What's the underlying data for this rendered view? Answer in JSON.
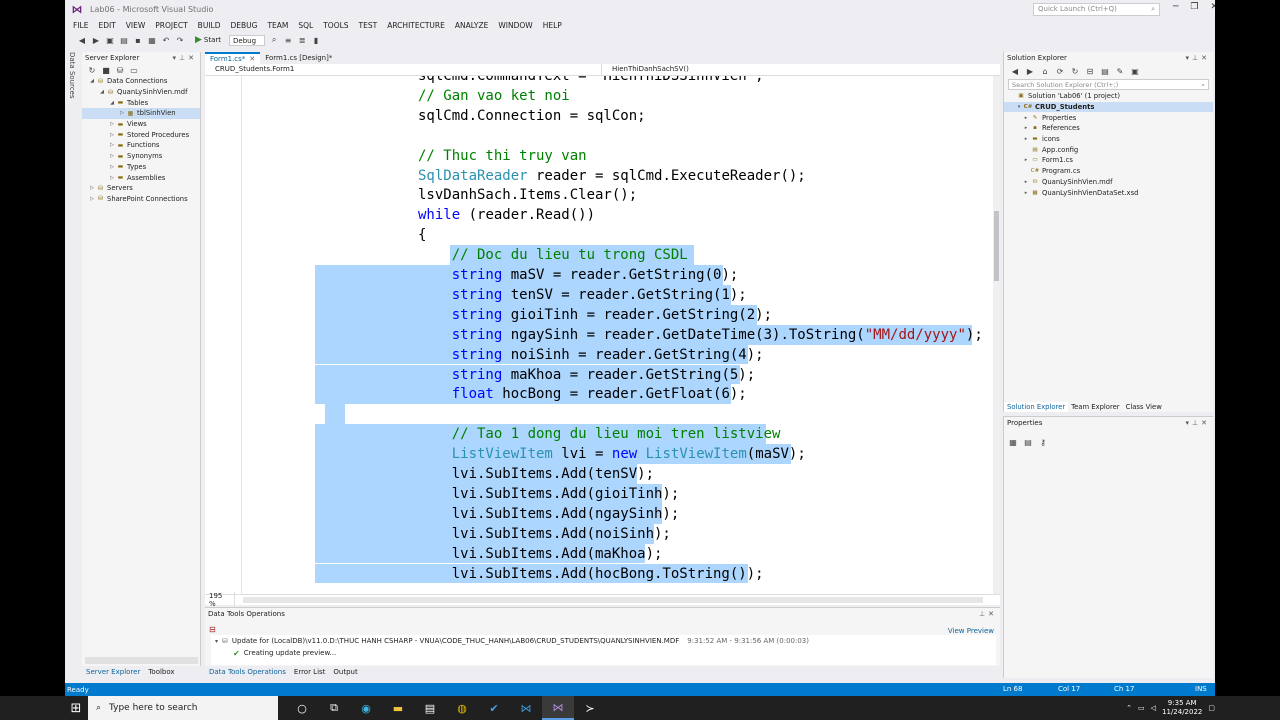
{
  "window": {
    "title": "Lab06 - Microsoft Visual Studio",
    "quick_launch": "Quick Launch (Ctrl+Q)"
  },
  "menu": [
    "FILE",
    "EDIT",
    "VIEW",
    "PROJECT",
    "BUILD",
    "DEBUG",
    "TEAM",
    "SQL",
    "TOOLS",
    "TEST",
    "ARCHITECTURE",
    "ANALYZE",
    "WINDOW",
    "HELP"
  ],
  "toolbar": {
    "start_label": "Start",
    "config_label": "Debug"
  },
  "side_tab": "Data Sources",
  "server_explorer": {
    "title": "Server Explorer",
    "tree": [
      {
        "label": "Data Connections",
        "indent": 0,
        "expanded": true
      },
      {
        "label": "QuanLySinhVien.mdf",
        "indent": 1,
        "expanded": true
      },
      {
        "label": "Tables",
        "indent": 2,
        "expanded": true
      },
      {
        "label": "tblSinhVien",
        "indent": 3,
        "expanded": false,
        "selected": true
      },
      {
        "label": "Views",
        "indent": 2,
        "expanded": false
      },
      {
        "label": "Stored Procedures",
        "indent": 2,
        "expanded": false
      },
      {
        "label": "Functions",
        "indent": 2,
        "expanded": false
      },
      {
        "label": "Synonyms",
        "indent": 2,
        "expanded": false
      },
      {
        "label": "Types",
        "indent": 2,
        "expanded": false
      },
      {
        "label": "Assemblies",
        "indent": 2,
        "expanded": false
      },
      {
        "label": "Servers",
        "indent": 0,
        "expanded": false
      },
      {
        "label": "SharePoint Connections",
        "indent": 0,
        "expanded": false
      }
    ],
    "bottom_tabs": [
      "Server Explorer",
      "Toolbox"
    ]
  },
  "editor": {
    "tabs": [
      {
        "label": "Form1.cs*",
        "active": true
      },
      {
        "label": "Form1.cs [Design]*",
        "active": false
      }
    ],
    "nav_left": "CRUD_Students.Form1",
    "nav_right": "HienThiDanhSachSV()",
    "zoom": "195 %",
    "lines": [
      [
        {
          "t": "sqlCmd.CommandText = \"HienThiDSSinhVien\";",
          "c": ""
        }
      ],
      [
        {
          "t": "// Gan vao ket noi",
          "c": "cm"
        }
      ],
      [
        {
          "t": "sqlCmd.Connection = sqlCon;",
          "c": ""
        }
      ],
      [
        {
          "t": "",
          "c": ""
        }
      ],
      [
        {
          "t": "// Thuc thi truy van",
          "c": "cm"
        }
      ],
      [
        {
          "t": "SqlDataReader",
          "c": "ty"
        },
        {
          "t": " reader = sqlCmd.ExecuteReader();",
          "c": ""
        }
      ],
      [
        {
          "t": "lsvDanhSach.Items.Clear();",
          "c": ""
        }
      ],
      [
        {
          "t": "while",
          "c": "kw"
        },
        {
          "t": " (reader.Read())",
          "c": ""
        }
      ],
      [
        {
          "t": "{",
          "c": ""
        }
      ],
      [
        {
          "t": "    // Doc du lieu tu trong CSDL",
          "c": "cm"
        }
      ],
      [
        {
          "t": "    ",
          "c": ""
        },
        {
          "t": "string",
          "c": "kw"
        },
        {
          "t": " maSV = reader.GetString(0);",
          "c": ""
        }
      ],
      [
        {
          "t": "    ",
          "c": ""
        },
        {
          "t": "string",
          "c": "kw"
        },
        {
          "t": " tenSV = reader.GetString(1);",
          "c": ""
        }
      ],
      [
        {
          "t": "    ",
          "c": ""
        },
        {
          "t": "string",
          "c": "kw"
        },
        {
          "t": " gioiTinh = reader.GetString(2);",
          "c": ""
        }
      ],
      [
        {
          "t": "    ",
          "c": ""
        },
        {
          "t": "string",
          "c": "kw"
        },
        {
          "t": " ngaySinh = reader.GetDateTime(3).ToString(",
          "c": ""
        },
        {
          "t": "\"MM/dd/yyyy\"",
          "c": "st"
        },
        {
          "t": ");",
          "c": ""
        }
      ],
      [
        {
          "t": "    ",
          "c": ""
        },
        {
          "t": "string",
          "c": "kw"
        },
        {
          "t": " noiSinh = reader.GetString(4);",
          "c": ""
        }
      ],
      [
        {
          "t": "    ",
          "c": ""
        },
        {
          "t": "string",
          "c": "kw"
        },
        {
          "t": " maKhoa = reader.GetString(5);",
          "c": ""
        }
      ],
      [
        {
          "t": "    ",
          "c": ""
        },
        {
          "t": "float",
          "c": "kw"
        },
        {
          "t": " hocBong = reader.GetFloat(6);",
          "c": ""
        }
      ],
      [
        {
          "t": "",
          "c": ""
        }
      ],
      [
        {
          "t": "    // Tao 1 dong du lieu moi tren listview",
          "c": "cm"
        }
      ],
      [
        {
          "t": "    ",
          "c": ""
        },
        {
          "t": "ListViewItem",
          "c": "ty"
        },
        {
          "t": " lvi = ",
          "c": ""
        },
        {
          "t": "new",
          "c": "kw"
        },
        {
          "t": " ",
          "c": ""
        },
        {
          "t": "ListViewItem",
          "c": "ty"
        },
        {
          "t": "(maSV);",
          "c": ""
        }
      ],
      [
        {
          "t": "    lvi.SubItems.Add(tenSV);",
          "c": ""
        }
      ],
      [
        {
          "t": "    lvi.SubItems.Add(gioiTinh);",
          "c": ""
        }
      ],
      [
        {
          "t": "    lvi.SubItems.Add(ngaySinh);",
          "c": ""
        }
      ],
      [
        {
          "t": "    lvi.SubItems.Add(noiSinh);",
          "c": ""
        }
      ],
      [
        {
          "t": "    lvi.SubItems.Add(maKhoa);",
          "c": ""
        }
      ],
      [
        {
          "t": "    lvi.SubItems.Add(hocBong.ToString());",
          "c": ""
        }
      ]
    ]
  },
  "data_tools": {
    "title": "Data Tools Operations",
    "op_text": "Update for (LocalDB)\\v11.0.D:\\THUC HANH CSHARP - VNUA\\CODE_THUC_HANH\\LAB06\\CRUD_STUDENTS\\QUANLYSINHVIEN.MDF",
    "op_time": "9:31:52 AM - 9:31:56 AM (0:00:03)",
    "op_sub": "Creating update preview...",
    "view_preview": "View Preview",
    "bottom_tabs": [
      "Data Tools Operations",
      "Error List",
      "Output"
    ]
  },
  "solution_explorer": {
    "title": "Solution Explorer",
    "search": "Search Solution Explorer (Ctrl+;)",
    "tree": [
      {
        "label": "Solution 'Lab06' (1 project)",
        "indent": 0,
        "icon": "solution-icon",
        "arrow": ""
      },
      {
        "label": "CRUD_Students",
        "indent": 1,
        "icon": "project-icon",
        "arrow": "▾",
        "selected": true
      },
      {
        "label": "Properties",
        "indent": 2,
        "icon": "wrench-icon",
        "arrow": "▸"
      },
      {
        "label": "References",
        "indent": 2,
        "icon": "references-icon",
        "arrow": "▸"
      },
      {
        "label": "icons",
        "indent": 2,
        "icon": "folder-icon",
        "arrow": "▸"
      },
      {
        "label": "App.config",
        "indent": 2,
        "icon": "config-icon",
        "arrow": ""
      },
      {
        "label": "Form1.cs",
        "indent": 2,
        "icon": "form-icon",
        "arrow": "▸"
      },
      {
        "label": "Program.cs",
        "indent": 2,
        "icon": "cs-file-icon",
        "arrow": ""
      },
      {
        "label": "QuanLySinhVien.mdf",
        "indent": 2,
        "icon": "database-icon",
        "arrow": "▸"
      },
      {
        "label": "QuanLySinhVienDataSet.xsd",
        "indent": 2,
        "icon": "dataset-icon",
        "arrow": "▸"
      }
    ],
    "tabs": [
      "Solution Explorer",
      "Team Explorer",
      "Class View"
    ]
  },
  "properties": {
    "title": "Properties"
  },
  "status": {
    "ready": "Ready",
    "ln": "Ln 68",
    "col": "Col 17",
    "ch": "Ch 17",
    "ins": "INS"
  },
  "taskbar": {
    "search": "Type here to search",
    "time": "9:35 AM",
    "date": "11/24/2022"
  },
  "colors": {
    "accent": "#007acc",
    "keyword": "#0000ff",
    "type": "#2b91af",
    "comment": "#008000",
    "string": "#a31515",
    "selection": "#add6ff"
  }
}
